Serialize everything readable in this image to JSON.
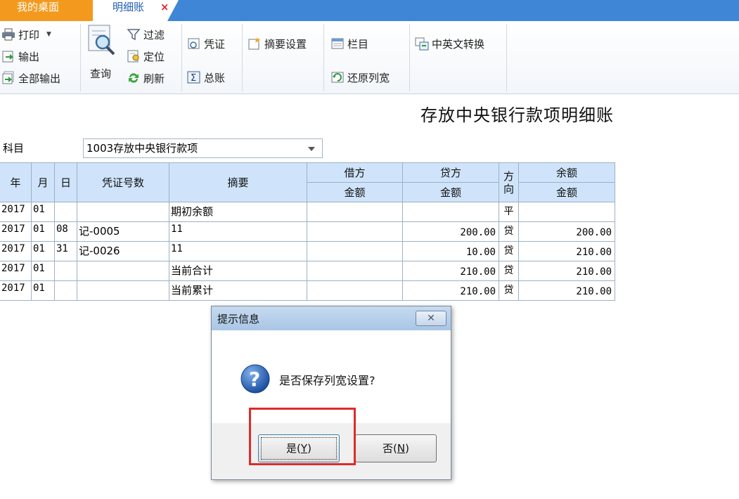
{
  "tabs": {
    "home_label": "我的桌面",
    "active_label": "明细账",
    "close_glyph": "×"
  },
  "toolbar": {
    "print": "打印",
    "export": "输出",
    "export_all": "全部输出",
    "query": "查询",
    "filter": "过滤",
    "locate": "定位",
    "refresh": "刷新",
    "voucher": "凭证",
    "general_ledger": "总账",
    "summary_settings": "摘要设置",
    "columns": "栏目",
    "restore_width": "还原列宽",
    "cn_en_switch": "中英文转换"
  },
  "report": {
    "title": "存放中央银行款项明细账",
    "subject_label": "科目",
    "subject_value": "1003存放中央银行款项"
  },
  "table": {
    "headers": {
      "year": "年",
      "month": "月",
      "day": "日",
      "voucher_no": "凭证号数",
      "summary": "摘要",
      "debit": "借方",
      "debit_amount": "金额",
      "credit": "贷方",
      "credit_amount": "金额",
      "direction_1": "方",
      "direction_2": "向",
      "balance": "余额",
      "balance_amount": "金额"
    },
    "rows": [
      {
        "year": "2017",
        "month": "01",
        "day": "",
        "voucher": "",
        "summary": "期初余额",
        "debit": "",
        "credit": "",
        "direction": "平",
        "balance": ""
      },
      {
        "year": "2017",
        "month": "01",
        "day": "08",
        "voucher": "记-0005",
        "summary": "11",
        "debit": "",
        "credit": "200.00",
        "direction": "贷",
        "balance": "200.00"
      },
      {
        "year": "2017",
        "month": "01",
        "day": "31",
        "voucher": "记-0026",
        "summary": "11",
        "debit": "",
        "credit": "10.00",
        "direction": "贷",
        "balance": "210.00"
      },
      {
        "year": "2017",
        "month": "01",
        "day": "",
        "voucher": "",
        "summary": "当前合计",
        "debit": "",
        "credit": "210.00",
        "direction": "贷",
        "balance": "210.00"
      },
      {
        "year": "2017",
        "month": "01",
        "day": "",
        "voucher": "",
        "summary": "当前累计",
        "debit": "",
        "credit": "210.00",
        "direction": "贷",
        "balance": "210.00"
      }
    ]
  },
  "dialog": {
    "title": "提示信息",
    "close_glyph": "✕",
    "message": "是否保存列宽设置?",
    "yes_text": "是(",
    "yes_key": "Y",
    "yes_end": ")",
    "no_text": "否(",
    "no_key": "N",
    "no_end": ")"
  },
  "colors": {
    "tab_bar": "#3f87d6",
    "home_tab": "#f39a1e",
    "header_fill": "#cfe4fa",
    "highlight": "#e02a2a"
  }
}
